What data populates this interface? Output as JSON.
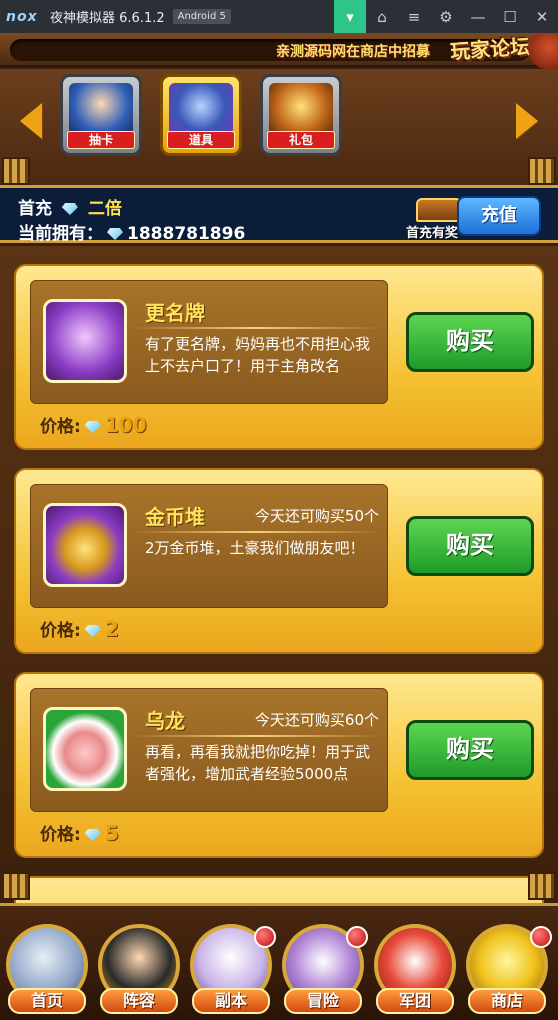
{
  "titlebar": {
    "logo": "nox",
    "title": "夜神模拟器 6.6.1.2",
    "android": "Android 5",
    "icons": [
      "gift-icon",
      "pin-icon",
      "menu-icon",
      "gear-icon",
      "minimize-icon",
      "maximize-icon",
      "close-icon"
    ]
  },
  "banner": {
    "marquee": "亲测源码网在商店中招募",
    "forum": "玩家论坛"
  },
  "tabs": [
    {
      "label": "抽卡"
    },
    {
      "label": "道具"
    },
    {
      "label": "礼包"
    }
  ],
  "info": {
    "first_charge": "首充",
    "double": "二倍",
    "current_label": "当前拥有：",
    "diamonds": "1888781896",
    "reward_caption": "首充有奖",
    "recharge_label": "充值"
  },
  "items": [
    {
      "name": "更名牌",
      "limit": "",
      "desc": "有了更名牌，妈妈再也不用担心我上不去户口了！用于主角改名",
      "price_label": "价格:",
      "price": "100",
      "buy": "购买",
      "icon_color": "#8b3cc4"
    },
    {
      "name": "金币堆",
      "limit": "今天还可购买50个",
      "desc": "2万金币堆，土豪我们做朋友吧！",
      "price_label": "价格:",
      "price": "2",
      "buy": "购买",
      "icon_color": "#8b3cc4"
    },
    {
      "name": "乌龙",
      "limit": "今天还可购买60个",
      "desc": "再看，再看我就把你吃掉！用于武者强化，增加武者经验5000点",
      "price_label": "价格:",
      "price": "5",
      "buy": "购买",
      "icon_color": "#2aa53a"
    }
  ],
  "nav": [
    {
      "label": "首页",
      "badge": false
    },
    {
      "label": "阵容",
      "badge": false
    },
    {
      "label": "副本",
      "badge": true
    },
    {
      "label": "冒险",
      "badge": true
    },
    {
      "label": "军团",
      "badge": false
    },
    {
      "label": "商店",
      "badge": true
    }
  ],
  "colors": {
    "gold": "#ffe35a",
    "buy_green": "#1f9a2a",
    "info_bg": "#0c1d3a",
    "card": "#f5c234"
  }
}
